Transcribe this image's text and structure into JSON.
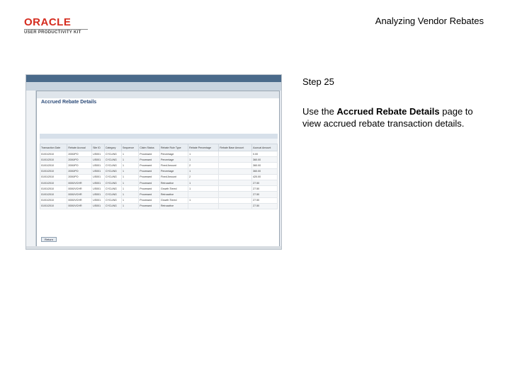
{
  "header": {
    "logo_word": "ORACLE",
    "logo_sub": "USER PRODUCTIVITY KIT",
    "slide_title": "Analyzing Vendor Rebates"
  },
  "step": {
    "number": "Step 25",
    "text_prefix": "Use the ",
    "text_bold": "Accrued Rebate Details",
    "text_suffix": " page to view accrued rebate transaction details."
  },
  "screenshot": {
    "page_heading": "Accrued Rebate Details",
    "return_label": "Return",
    "tabs": [
      "Rebate Details",
      "PO",
      "Receipt",
      "Voucher",
      "RTV",
      "Claim",
      "Info"
    ],
    "columns": [
      "Transaction Date",
      "Rebate Accrual",
      "Site ID",
      "Category",
      "Sequence",
      "Claim Status",
      "Rebate Rule Type",
      "Rebate Percentage",
      "Rebate Base Amount",
      "Accrual Amount"
    ],
    "rows": [
      [
        "01/01/2010",
        "2000/PO",
        "US001",
        "CYCLING",
        "1",
        "Processed",
        "Percentage",
        "1",
        "",
        "0.00"
      ],
      [
        "01/01/2010",
        "2000/PO",
        "US001",
        "CYCLING",
        "1",
        "Processed",
        "Percentage",
        "1",
        "",
        "360.00"
      ],
      [
        "01/01/2010",
        "2000/PO",
        "US001",
        "CYCLING",
        "1",
        "Processed",
        "Fixed Amount",
        "2",
        "",
        "360.00"
      ],
      [
        "01/01/2010",
        "2000/PO",
        "US001",
        "CYCLING",
        "1",
        "Processed",
        "Percentage",
        "1",
        "",
        "360.00"
      ],
      [
        "01/01/2010",
        "2000/PO",
        "US001",
        "CYCLING",
        "1",
        "Processed",
        "Fixed Amount",
        "2",
        "",
        "420.00"
      ],
      [
        "01/01/2010",
        "0000/VCHR",
        "US001",
        "CYCLING",
        "1",
        "Processed",
        "Retroactive",
        "1",
        "",
        "27.50"
      ],
      [
        "01/01/2010",
        "0000/VCHR",
        "US001",
        "CYCLING",
        "1",
        "Processed",
        "Growth Tiered",
        "1",
        "",
        "27.50"
      ],
      [
        "01/01/2010",
        "0000/VCHR",
        "US001",
        "CYCLING",
        "1",
        "Processed",
        "Retroactive",
        "",
        "",
        "27.50"
      ],
      [
        "01/01/2010",
        "0000/VCHR",
        "US001",
        "CYCLING",
        "1",
        "Processed",
        "Growth Tiered",
        "1",
        "",
        "27.50"
      ],
      [
        "01/01/2010",
        "0000/VCHR",
        "US001",
        "CYCLING",
        "1",
        "Processed",
        "Retroactive",
        "",
        "",
        "27.50"
      ]
    ]
  }
}
